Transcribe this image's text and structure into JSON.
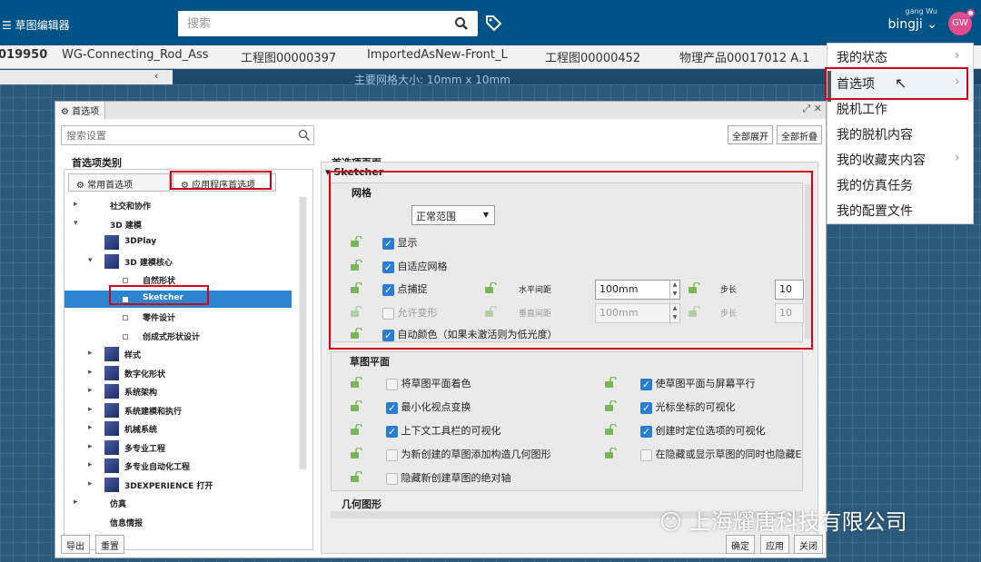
{
  "app_title": "☰ 草图编辑器",
  "search": {
    "placeholder": "搜索"
  },
  "user": {
    "small": "gang Wu",
    "name": "bingji ⌄",
    "avatar": "GW"
  },
  "tabs": [
    "019950",
    "WG-Connecting_Rod_Ass",
    "工程图00000397",
    "ImportedAsNew-Front_L",
    "工程图00000452",
    "物理产品00017012 A.1"
  ],
  "sub_arrow": "‹",
  "grid_info": "主要网格大小:  10mm x 10mm",
  "dialog": {
    "title": "首选项",
    "search_placeholder": "搜索设置",
    "category_header": "首选项类别",
    "tab_common": "常用首选项",
    "tab_app": "应用程序首选项",
    "tree": [
      {
        "label": "社交和协作",
        "depth": 0,
        "arrow": "▸"
      },
      {
        "label": "3D 建模",
        "depth": 0,
        "arrow": "▾"
      },
      {
        "label": "3DPlay",
        "depth": 1,
        "arrow": ""
      },
      {
        "label": "3D 建模核心",
        "depth": 1,
        "arrow": "▾"
      },
      {
        "label": "自然形状",
        "depth": 2,
        "arrow": ""
      },
      {
        "label": "Sketcher",
        "depth": 2,
        "arrow": "",
        "selected": true
      },
      {
        "label": "零件设计",
        "depth": 2,
        "arrow": ""
      },
      {
        "label": "创成式形状设计",
        "depth": 2,
        "arrow": ""
      },
      {
        "label": "样式",
        "depth": 1,
        "arrow": "▸"
      },
      {
        "label": "数字化形状",
        "depth": 1,
        "arrow": "▸"
      },
      {
        "label": "系统架构",
        "depth": 1,
        "arrow": "▸"
      },
      {
        "label": "系统建模和执行",
        "depth": 1,
        "arrow": "▸"
      },
      {
        "label": "机械系统",
        "depth": 1,
        "arrow": "▸"
      },
      {
        "label": "多专业工程",
        "depth": 1,
        "arrow": "▸"
      },
      {
        "label": "多专业自动化工程",
        "depth": 1,
        "arrow": "▸"
      },
      {
        "label": "3DEXPERIENCE 打开",
        "depth": 1,
        "arrow": "▸"
      },
      {
        "label": "仿真",
        "depth": 0,
        "arrow": "▸"
      },
      {
        "label": "信息情报",
        "depth": 0,
        "arrow": ""
      }
    ],
    "page_header": "首选项页面",
    "expand_all": "全部展开",
    "collapse_all": "全部折叠",
    "section_title": "Sketcher",
    "grid": {
      "title": "网格",
      "range_select": "正常范围",
      "show": "显示",
      "adaptive": "自适应网格",
      "snap": "点捕捉",
      "h_spacing_label": "水平间距",
      "h_spacing": "100mm",
      "step_label": "步长",
      "step": "10",
      "allow_distort": "允许变形",
      "v_spacing_label": "垂直间距",
      "v_spacing": "100mm",
      "step2_label": "步长",
      "step2": "10",
      "auto_color": "自动颜色（如果未激活则为低光度）"
    },
    "sketch_plane": {
      "title": "草图平面",
      "items": [
        {
          "label": "将草图平面着色",
          "checked": false
        },
        {
          "label": "使草图平面与屏幕平行",
          "checked": true
        },
        {
          "label": "最小化视点变换",
          "checked": true
        },
        {
          "label": "光标坐标的可视化",
          "checked": true
        },
        {
          "label": "上下文工具栏的可视化",
          "checked": true
        },
        {
          "label": "创建时定位选项的可视化",
          "checked": true
        },
        {
          "label": "为新创建的草图添加构造几何图形",
          "checked": false
        },
        {
          "label": "在隐藏或显示草图的同时也隐藏Ε",
          "checked": false
        },
        {
          "label": "隐藏新创建草图的绝对轴",
          "checked": false
        }
      ]
    },
    "geometry_title": "几何图形",
    "export": "导出",
    "reset": "重置",
    "ok": "确定",
    "apply": "应用",
    "close": "关闭"
  },
  "menu": {
    "items": [
      "我的状态",
      "首选项",
      "脱机工作",
      "我的脱机内容",
      "我的收藏夹内容",
      "我的仿真任务",
      "我的配置文件"
    ]
  },
  "watermark": "上海耀唐科技有限公司",
  "colors": {
    "topbar": "#005386",
    "accent": "#2b7cd3",
    "highlight": "#d0021b"
  }
}
